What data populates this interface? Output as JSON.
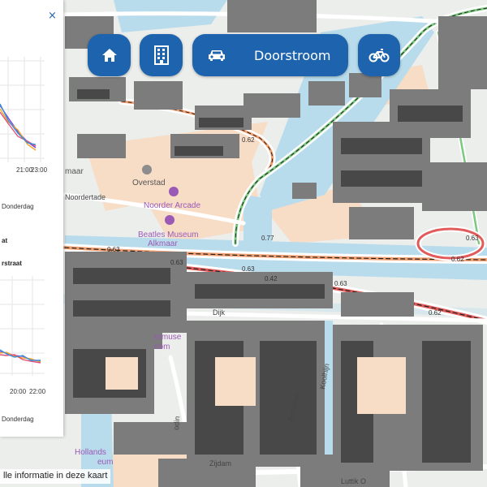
{
  "toolbar": {
    "home_icon": "home-icon",
    "building_icon": "building-icon",
    "car_icon": "car-icon",
    "traffic_label": "Doorstroom",
    "bike_icon": "bike-icon",
    "accent_color": "#1e63ad"
  },
  "panel": {
    "close_glyph": "×",
    "chart1": {
      "x_ticks": [
        "21:00",
        "23:00"
      ],
      "x_caption": "Donderdag"
    },
    "section_title_fragment": "at",
    "section_subtitle_fragment": "rstraat",
    "chart2": {
      "x_ticks": [
        "20:00",
        "22:00"
      ],
      "x_caption": "Donderdag"
    }
  },
  "map": {
    "poi_labels": {
      "overstad": "Overstad",
      "noorder_arcade": "Noorder Arcade",
      "beatles_museum_1": "Beatles Museum",
      "beatles_museum_2": "Alkmaar",
      "maar": "maar",
      "oordertade": "Noordertade",
      "museum_1": "ermuse",
      "museum_2": "oom",
      "hollands_1": "Hollands",
      "hollands_2": "eum"
    },
    "street_labels": {
      "dijk": "Dijk",
      "zijdam": "Zijdam",
      "luttik": "Luttik O",
      "achterstr": "Achterstr",
      "koolhijn": "Koolhijn",
      "rodin": "odin"
    },
    "road_values": [
      "0.62",
      "0.77",
      "0.63",
      "0.63",
      "0.42",
      "0.63",
      "0.62",
      "0.63",
      "0.63",
      "0.62"
    ]
  },
  "attribution": "lle informatie in deze kaart"
}
